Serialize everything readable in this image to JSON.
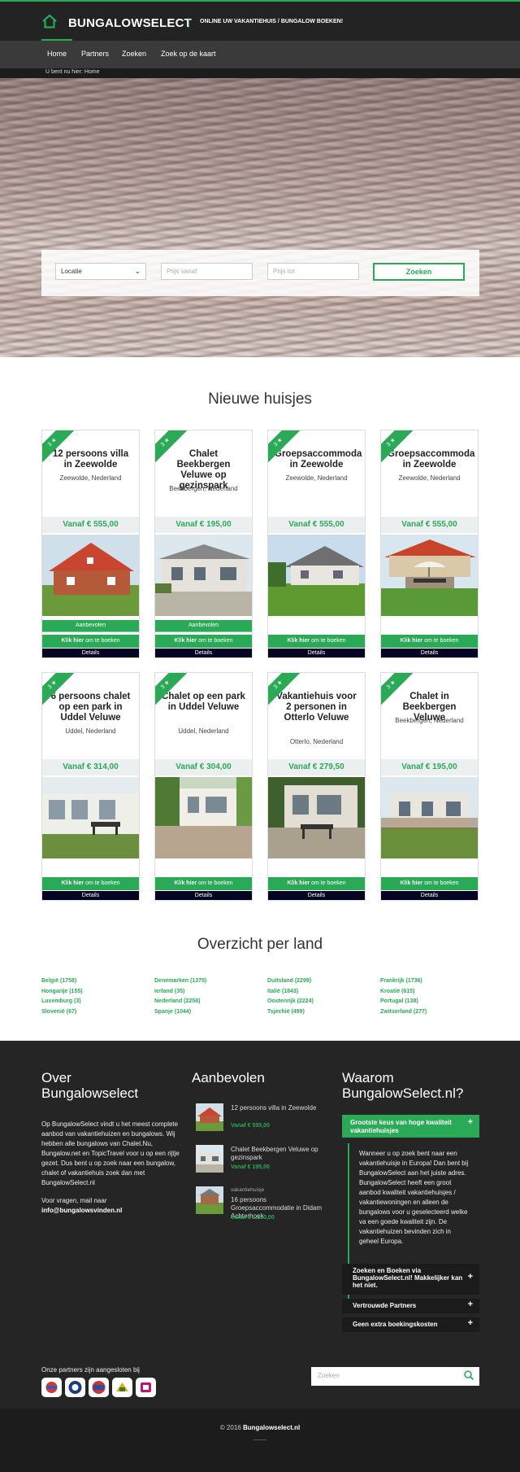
{
  "header": {
    "logo": "BUNGALOWSELECT",
    "tagline": "ONLINE UW VAKANTIEHUIS / BUNGALOW BOEKEN!",
    "nav": [
      "Home",
      "Partners",
      "Zoeken",
      "Zoek op de kaart"
    ],
    "breadcrumb": "U bent nu hier: Home"
  },
  "search": {
    "location": "Locatie",
    "price_from": "Prijs vanaf",
    "price_to": "Prijs tot",
    "button": "Zoeken"
  },
  "new_title": "Nieuwe huisjes",
  "cards": [
    {
      "title": "12 persoons villa in Zeewolde",
      "location": "Zeewolde, Nederland",
      "price": "Vanaf € 555,00",
      "recommended": "Aanbevolen"
    },
    {
      "title": "Chalet Beekbergen Veluwe op gezinspark",
      "location": "Beekbergen, Nederland",
      "price": "Vanaf € 195,00",
      "recommended": "Aanbevolen"
    },
    {
      "title": "Groepsaccommoda in Zeewolde",
      "location": "Zeewolde, Nederland",
      "price": "Vanaf € 555,00",
      "recommended": ""
    },
    {
      "title": "Groepsaccommoda in Zeewolde",
      "location": "Zeewolde, Nederland",
      "price": "Vanaf € 555,00",
      "recommended": ""
    },
    {
      "title": "6 persoons chalet op een park in Uddel Veluwe",
      "location": "Uddel, Nederland",
      "price": "Vanaf € 314,00",
      "recommended": ""
    },
    {
      "title": "Chalet op een park in Uddel Veluwe",
      "location": "Uddel, Nederland",
      "price": "Vanaf € 304,00",
      "recommended": ""
    },
    {
      "title": "Vakantiehuis voor 2 personen in Otterlo Veluwe",
      "location": "Otterlo, Nederland",
      "price": "Vanaf € 279,50",
      "recommended": ""
    },
    {
      "title": "Chalet in Beekbergen Veluwe",
      "location": "Beekbergen, Nederland",
      "price": "Vanaf € 195,00",
      "recommended": ""
    }
  ],
  "card_labels": {
    "ribbon": "3 ★",
    "book_strong": "Klik hier",
    "book_rest": " om te boeken",
    "details": "Details"
  },
  "country_title": "Overzicht per land",
  "countries": [
    [
      "België (1758)",
      "Hongarije (155)",
      "Luxemburg (3)",
      "Slovenië (67)"
    ],
    [
      "Denemarken (1375)",
      "Ierland (35)",
      "Nederland (2258)",
      "Spanje (1044)"
    ],
    [
      "Duitsland (2299)",
      "Italië (1843)",
      "Oostenrijk (2224)",
      "Tsjechië (499)"
    ],
    [
      "Frankrijk (1736)",
      "Kroatië (615)",
      "Portugal (138)",
      "Zwitserland (277)"
    ]
  ],
  "footer": {
    "about_title": "Over Bungalowselect",
    "about_text": "Op BungalowSelect vindt u het meest complete aanbod van vakantiehuizen en bungalows. Wij hebben alle bungalows van Chalet.Nu, Bungalow.net en TopicTravel voor u op een rijtje gezet. Dus bent u op zoek naar een bungalow, chalet of vakantiehuis zoek dan met BungalowSelect.nl",
    "about_mail_text": "Voor vragen, mail naar",
    "about_mail": "info@bungalowsvinden.nl",
    "rec_title": "Aanbevolen",
    "recommended": [
      {
        "sub": "",
        "title": "12 persoons villa in Zeewolde",
        "price": "Vanaf € 555,00"
      },
      {
        "sub": "",
        "title": "Chalet Beekbergen Veluwe op gezinspark",
        "price": "Vanaf € 195,00"
      },
      {
        "sub": "vakantiehuisje",
        "title": "16 persoons Groepsaccommodatie in Didam Achterhoek",
        "price": "Vanaf € 1.200,00"
      }
    ],
    "why_title": "Waarom BungalowSelect.nl?",
    "acc_open": "Grootste keus van hoge kwaliteit vakantiehuisjes",
    "acc_text": "Wanneer u op zoek bent naar een vakantiehuisje in Europa! Dan bent bij BungalowSelect aan het juiste adres. BungalowSelect heeft een groot aanbod kwaliteit vakantiehuisjes / vakantiewoningen en alleen de bungalows voor u geselecteerd welke va een goede kwaliteit zijn. De vakantiehuizen bevinden zich in geheel Europa.",
    "acc_items": [
      "Zoeken en Boeken via BungalowSelect.nl! Makkelijker kan het niet.",
      "Vertrouwde Partners",
      "Geen extra boekingskosten"
    ],
    "partners": "Onze partners zijn aangesloten bij",
    "search_placeholder": "Zoeken",
    "copyright_prefix": "© 2016 ",
    "copyright_site": "Bungalowselect.nl"
  }
}
